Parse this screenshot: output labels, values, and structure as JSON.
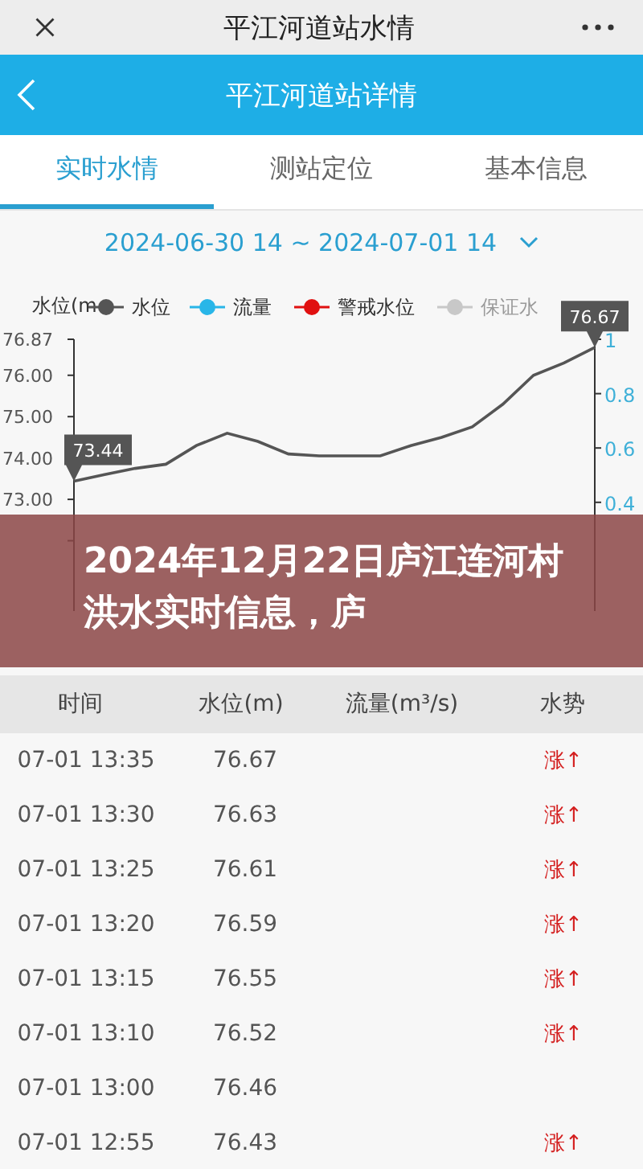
{
  "window": {
    "title": "平江河道站水情"
  },
  "header": {
    "title": "平江河道站详情"
  },
  "tabs": [
    {
      "label": "实时水情",
      "selected": true
    },
    {
      "label": "测站定位",
      "selected": false
    },
    {
      "label": "基本信息",
      "selected": false
    }
  ],
  "date_range": "2024-06-30 14 ~ 2024-07-01 14",
  "legend": [
    {
      "color": "#555555",
      "on": true
    },
    {
      "label": "流量",
      "color": "#29b6e8",
      "on": true
    },
    {
      "label": "警戒水位",
      "color": "#e01010",
      "on": true
    },
    {
      "label": "保证水",
      "color": "#c8c8c8",
      "on": false
    }
  ],
  "chart_data": {
    "type": "line",
    "ylabel": "水位(m",
    "ylim": [
      70.3,
      76.87
    ],
    "yticks": [
      {
        "value": 76.87,
        "label": "76.87"
      },
      {
        "value": 76,
        "label": "76.00"
      },
      {
        "value": 75,
        "label": "75.00"
      },
      {
        "value": 74,
        "label": "74.00"
      },
      {
        "value": 73,
        "label": "73.00"
      }
    ],
    "series": [
      {
        "name": "水位",
        "color": "#555555",
        "values": [
          73.44,
          73.6,
          73.75,
          73.85,
          74.3,
          74.6,
          74.4,
          74.1,
          74.05,
          74.05,
          74.05,
          74.3,
          74.5,
          74.75,
          75.3,
          76.0,
          76.3,
          76.67
        ]
      }
    ],
    "annotations": [
      "73.44",
      "76.67"
    ]
  },
  "right_axis_ticks": [
    "1",
    "0.8",
    "0.6",
    "0.4"
  ],
  "banner": "2024年12月22日庐江连河村洪水实时信息，庐",
  "table": {
    "columns": [
      "时间",
      "水位(m)",
      "流量(m³/s)",
      "水势"
    ],
    "rows": [
      {
        "time": "07-01 13:35",
        "level": "76.67",
        "trend": "涨↑"
      },
      {
        "time": "07-01 13:30",
        "level": "76.63",
        "trend": "涨↑"
      },
      {
        "time": "07-01 13:25",
        "level": "76.61",
        "trend": "涨↑"
      },
      {
        "time": "07-01 13:20",
        "level": "76.59",
        "trend": "涨↑"
      },
      {
        "time": "07-01 13:15",
        "level": "76.55",
        "trend": "涨↑"
      },
      {
        "time": "07-01 13:10",
        "level": "76.52",
        "trend": "涨↑"
      },
      {
        "time": "07-01 13:00",
        "level": "76.46"
      },
      {
        "time": "07-01 12:55",
        "level": "76.43",
        "trend": "涨↑"
      }
    ]
  }
}
